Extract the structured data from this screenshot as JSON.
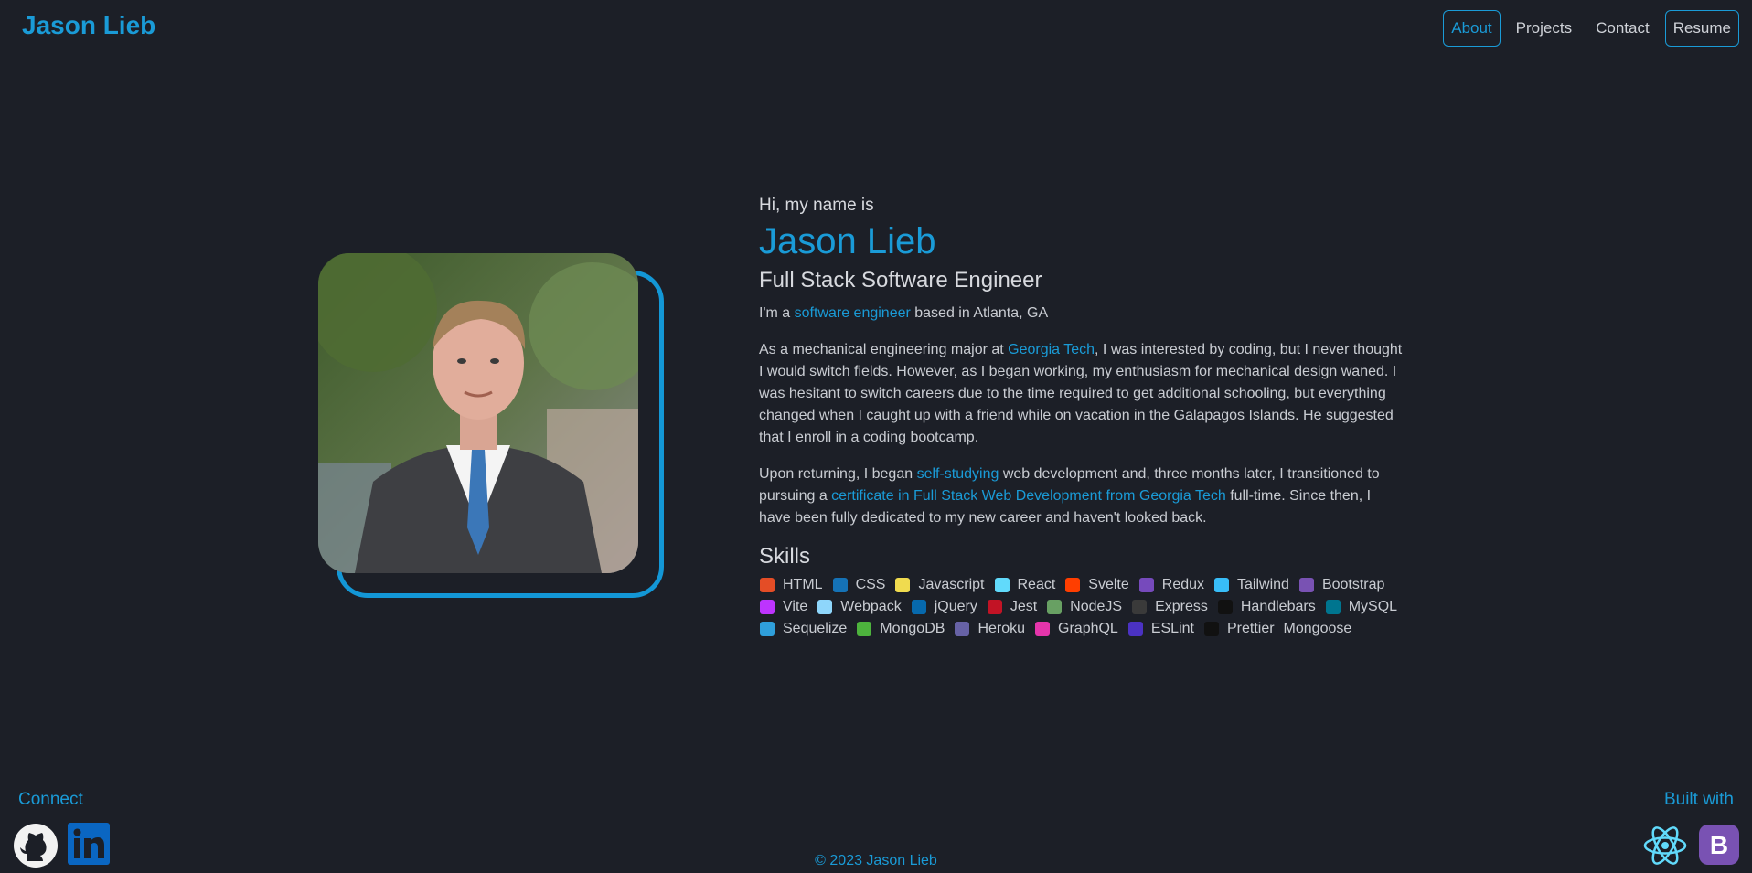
{
  "header": {
    "brand": "Jason Lieb",
    "nav": [
      {
        "label": "About"
      },
      {
        "label": "Projects"
      },
      {
        "label": "Contact"
      },
      {
        "label": "Resume"
      }
    ]
  },
  "about": {
    "greeting": "Hi, my name is",
    "name": "Jason Lieb",
    "role": "Full Stack Software Engineer",
    "intro": {
      "pre": "I'm a ",
      "highlight": "software engineer",
      "post": " based in Atlanta, GA"
    },
    "para1": {
      "pre": "As a mechanical engineering major at ",
      "highlight": "Georgia Tech",
      "post": ", I was interested by coding, but I never thought I would switch fields. However, as I began working, my enthusiasm for mechanical design waned. I was hesitant to switch careers due to the time required to get additional schooling, but everything changed when I caught up with a friend while on vacation in the Galapagos Islands. He suggested that I enroll in a coding bootcamp."
    },
    "para2": {
      "pre": "Upon returning, I began ",
      "highlight1": "self-studying",
      "mid": " web development and, three months later, I transitioned to pursuing a ",
      "highlight2": "certificate in Full Stack Web Development from Georgia Tech",
      "post": " full-time. Since then, I have been fully dedicated to my new career and haven't looked back."
    },
    "skills_title": "Skills",
    "skills": [
      {
        "label": "HTML",
        "icon": "html5-icon",
        "color": "#e44d26"
      },
      {
        "label": "CSS",
        "icon": "css3-icon",
        "color": "#1572b6"
      },
      {
        "label": "Javascript",
        "icon": "javascript-icon",
        "color": "#f0db4f"
      },
      {
        "label": "React",
        "icon": "react-icon",
        "color": "#61dafb"
      },
      {
        "label": "Svelte",
        "icon": "svelte-icon",
        "color": "#ff3e00"
      },
      {
        "label": "Redux",
        "icon": "redux-icon",
        "color": "#764abc"
      },
      {
        "label": "Tailwind",
        "icon": "tailwind-icon",
        "color": "#38bdf8"
      },
      {
        "label": "Bootstrap",
        "icon": "bootstrap-icon",
        "color": "#7952b3"
      },
      {
        "label": "Vite",
        "icon": "vite-icon",
        "color": "#bd34fe"
      },
      {
        "label": "Webpack",
        "icon": "webpack-icon",
        "color": "#8ed6fb"
      },
      {
        "label": "jQuery",
        "icon": "jquery-icon",
        "color": "#0769ad"
      },
      {
        "label": "Jest",
        "icon": "jest-icon",
        "color": "#c21325"
      },
      {
        "label": "NodeJS",
        "icon": "nodejs-icon",
        "color": "#68a063"
      },
      {
        "label": "Express",
        "icon": "express-icon",
        "color": "#3a3a3a"
      },
      {
        "label": "Handlebars",
        "icon": "handlebars-icon",
        "color": "#111111"
      },
      {
        "label": "MySQL",
        "icon": "mysql-icon",
        "color": "#00758f"
      },
      {
        "label": "Sequelize",
        "icon": "sequelize-icon",
        "color": "#2f9fdb"
      },
      {
        "label": "MongoDB",
        "icon": "mongodb-icon",
        "color": "#4db33d"
      },
      {
        "label": "Heroku",
        "icon": "heroku-icon",
        "color": "#6762a6"
      },
      {
        "label": "GraphQL",
        "icon": "graphql-icon",
        "color": "#e535ab"
      },
      {
        "label": "ESLint",
        "icon": "eslint-icon",
        "color": "#4b32c3"
      },
      {
        "label": "Prettier",
        "icon": "prettier-icon",
        "color": "#111111"
      },
      {
        "label": "Mongoose",
        "icon": "",
        "color": ""
      }
    ]
  },
  "footer": {
    "connect": "Connect",
    "built_with": "Built with",
    "copyright": "© 2023 Jason Lieb"
  },
  "colors": {
    "accent": "#1a9bd7",
    "background": "#1c1f27"
  }
}
